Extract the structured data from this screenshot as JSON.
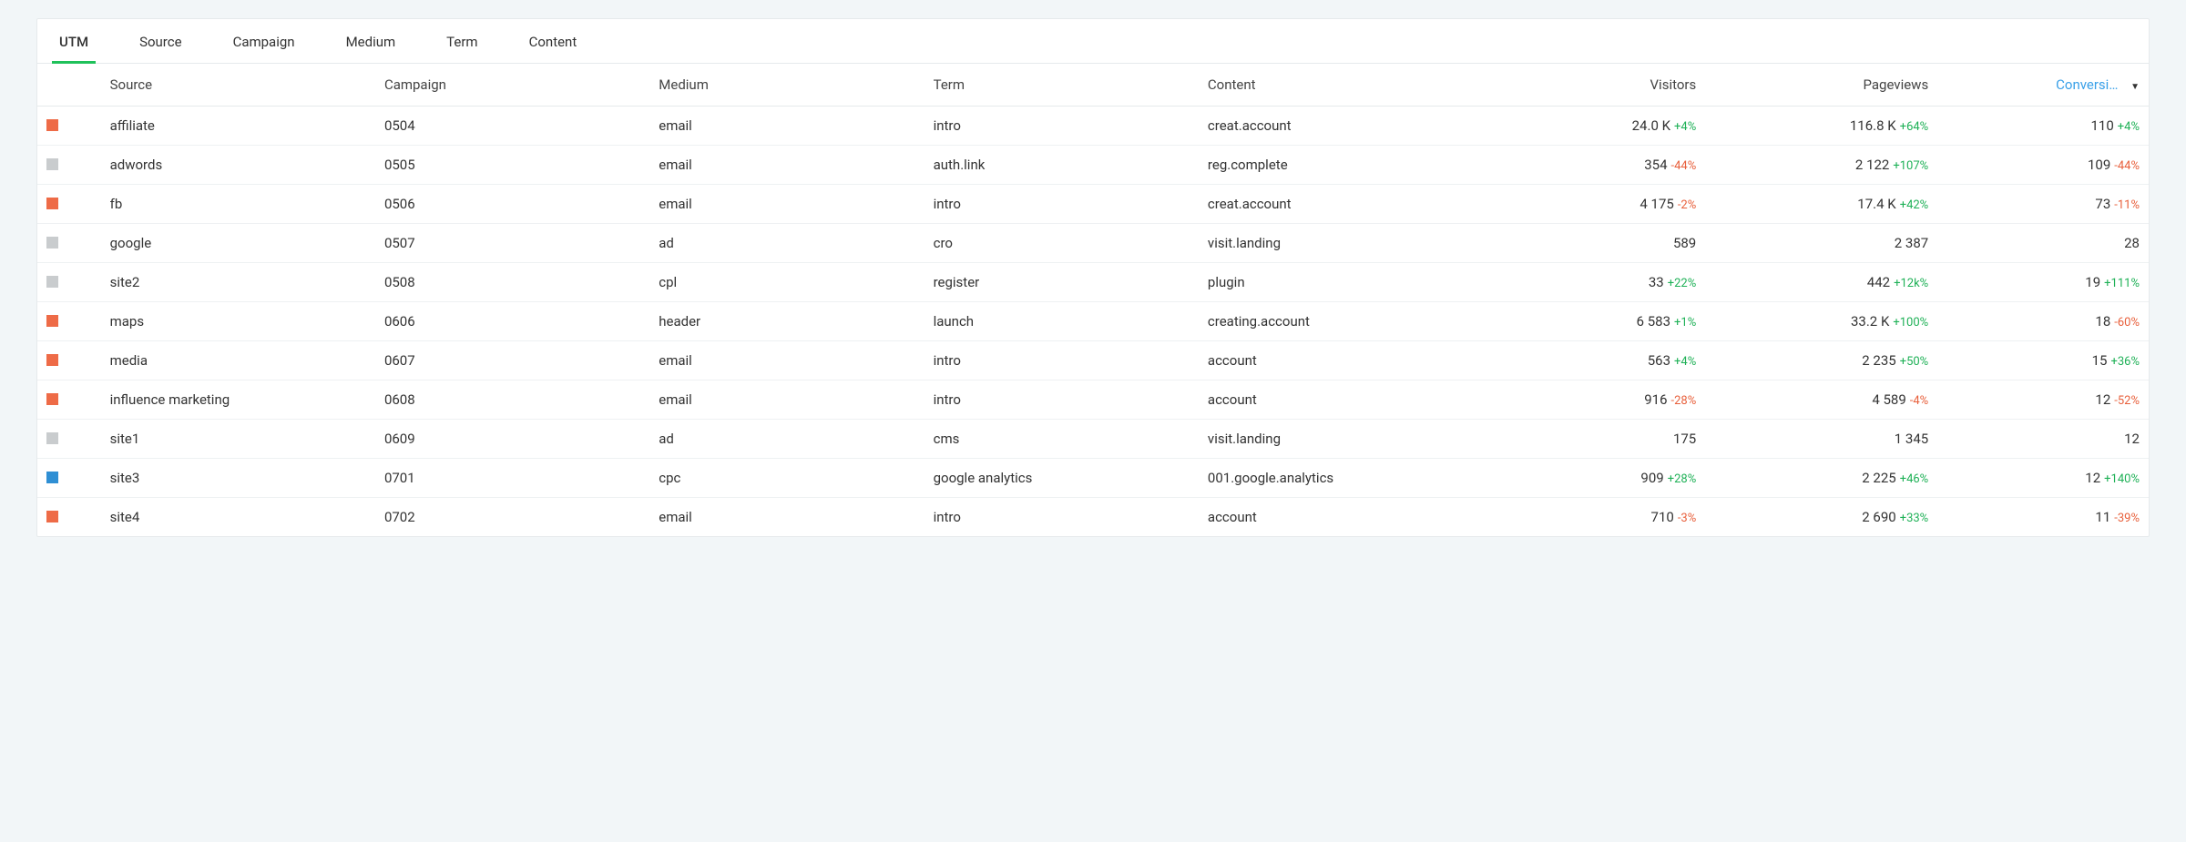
{
  "tabs": {
    "items": [
      {
        "label": "UTM",
        "active": true
      },
      {
        "label": "Source",
        "active": false
      },
      {
        "label": "Campaign",
        "active": false
      },
      {
        "label": "Medium",
        "active": false
      },
      {
        "label": "Term",
        "active": false
      },
      {
        "label": "Content",
        "active": false
      }
    ]
  },
  "table": {
    "headers": {
      "source": "Source",
      "campaign": "Campaign",
      "medium": "Medium",
      "term": "Term",
      "content": "Content",
      "visitors": "Visitors",
      "pageviews": "Pageviews",
      "conversions": "Conversi…"
    },
    "sort_column": "conversions",
    "sort_dir": "desc",
    "rows": [
      {
        "color": "#ee6b47",
        "source": "affiliate",
        "campaign": "0504",
        "medium": "email",
        "term": "intro",
        "content": "creat.account",
        "visitors": "24.0 K",
        "visitors_delta": "+4%",
        "visitors_delta_dir": "up",
        "pageviews": "116.8 K",
        "pageviews_delta": "+64%",
        "pageviews_delta_dir": "up",
        "conversions": "110",
        "conversions_delta": "+4%",
        "conversions_delta_dir": "up"
      },
      {
        "color": "#c9ccce",
        "source": "adwords",
        "campaign": "0505",
        "medium": "email",
        "term": "auth.link",
        "content": "reg.complete",
        "visitors": "354",
        "visitors_delta": "-44%",
        "visitors_delta_dir": "down",
        "pageviews": "2 122",
        "pageviews_delta": "+107%",
        "pageviews_delta_dir": "up",
        "conversions": "109",
        "conversions_delta": "-44%",
        "conversions_delta_dir": "down"
      },
      {
        "color": "#ee6b47",
        "source": "fb",
        "campaign": "0506",
        "medium": "email",
        "term": "intro",
        "content": "creat.account",
        "visitors": "4 175",
        "visitors_delta": "-2%",
        "visitors_delta_dir": "down",
        "pageviews": "17.4 K",
        "pageviews_delta": "+42%",
        "pageviews_delta_dir": "up",
        "conversions": "73",
        "conversions_delta": "-11%",
        "conversions_delta_dir": "down"
      },
      {
        "color": "#c9ccce",
        "source": "google",
        "campaign": "0507",
        "medium": "ad",
        "term": "cro",
        "content": "visit.landing",
        "visitors": "589",
        "visitors_delta": "",
        "visitors_delta_dir": "",
        "pageviews": "2 387",
        "pageviews_delta": "",
        "pageviews_delta_dir": "",
        "conversions": "28",
        "conversions_delta": "",
        "conversions_delta_dir": ""
      },
      {
        "color": "#c9ccce",
        "source": "site2",
        "campaign": "0508",
        "medium": "cpl",
        "term": "register",
        "content": "plugin",
        "visitors": "33",
        "visitors_delta": "+22%",
        "visitors_delta_dir": "up",
        "pageviews": "442",
        "pageviews_delta": "+12k%",
        "pageviews_delta_dir": "up",
        "conversions": "19",
        "conversions_delta": "+111%",
        "conversions_delta_dir": "up"
      },
      {
        "color": "#ee6b47",
        "source": "maps",
        "campaign": "0606",
        "medium": "header",
        "term": "launch",
        "content": "creating.account",
        "visitors": "6 583",
        "visitors_delta": "+1%",
        "visitors_delta_dir": "up",
        "pageviews": "33.2 K",
        "pageviews_delta": "+100%",
        "pageviews_delta_dir": "up",
        "conversions": "18",
        "conversions_delta": "-60%",
        "conversions_delta_dir": "down"
      },
      {
        "color": "#ee6b47",
        "source": "media",
        "campaign": "0607",
        "medium": "email",
        "term": "intro",
        "content": "account",
        "visitors": "563",
        "visitors_delta": "+4%",
        "visitors_delta_dir": "up",
        "pageviews": "2 235",
        "pageviews_delta": "+50%",
        "pageviews_delta_dir": "up",
        "conversions": "15",
        "conversions_delta": "+36%",
        "conversions_delta_dir": "up"
      },
      {
        "color": "#ee6b47",
        "source": "influence marketing",
        "campaign": "0608",
        "medium": "email",
        "term": "intro",
        "content": "account",
        "visitors": "916",
        "visitors_delta": "-28%",
        "visitors_delta_dir": "down",
        "pageviews": "4 589",
        "pageviews_delta": "-4%",
        "pageviews_delta_dir": "down",
        "conversions": "12",
        "conversions_delta": "-52%",
        "conversions_delta_dir": "down"
      },
      {
        "color": "#c9ccce",
        "source": "site1",
        "campaign": "0609",
        "medium": "ad",
        "term": "cms",
        "content": "visit.landing",
        "visitors": "175",
        "visitors_delta": "",
        "visitors_delta_dir": "",
        "pageviews": "1 345",
        "pageviews_delta": "",
        "pageviews_delta_dir": "",
        "conversions": "12",
        "conversions_delta": "",
        "conversions_delta_dir": ""
      },
      {
        "color": "#2f8fd4",
        "source": "site3",
        "campaign": "0701",
        "medium": "cpc",
        "term": "google analytics",
        "content": "001.google.analytics",
        "visitors": "909",
        "visitors_delta": "+28%",
        "visitors_delta_dir": "up",
        "pageviews": "2 225",
        "pageviews_delta": "+46%",
        "pageviews_delta_dir": "up",
        "conversions": "12",
        "conversions_delta": "+140%",
        "conversions_delta_dir": "up"
      },
      {
        "color": "#ee6b47",
        "source": "site4",
        "campaign": "0702",
        "medium": "email",
        "term": "intro",
        "content": "account",
        "visitors": "710",
        "visitors_delta": "-3%",
        "visitors_delta_dir": "down",
        "pageviews": "2 690",
        "pageviews_delta": "+33%",
        "pageviews_delta_dir": "up",
        "conversions": "11",
        "conversions_delta": "-39%",
        "conversions_delta_dir": "down"
      }
    ]
  }
}
